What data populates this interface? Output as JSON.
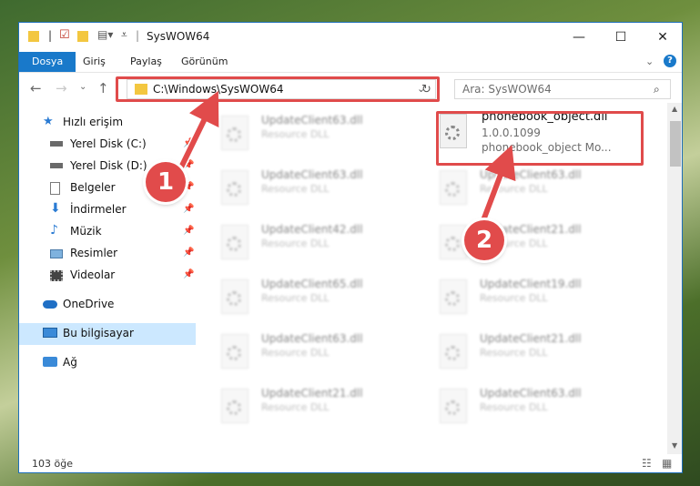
{
  "window": {
    "title": "SysWOW64"
  },
  "ribbon": {
    "tabs": [
      "Dosya",
      "Giriş",
      "Paylaş",
      "Görünüm"
    ]
  },
  "address": {
    "path": "C:\\Windows\\SysWOW64"
  },
  "search": {
    "placeholder": "Ara: SysWOW64"
  },
  "sidebar": {
    "items": [
      {
        "label": "Hızlı erişim",
        "icon": "star-icon"
      },
      {
        "label": "Yerel Disk (C:)",
        "icon": "drive-icon"
      },
      {
        "label": "Yerel Disk (D:)",
        "icon": "drive-icon"
      },
      {
        "label": "Belgeler",
        "icon": "documents-icon"
      },
      {
        "label": "İndirmeler",
        "icon": "download-icon"
      },
      {
        "label": "Müzik",
        "icon": "music-icon"
      },
      {
        "label": "Resimler",
        "icon": "pictures-icon"
      },
      {
        "label": "Videolar",
        "icon": "video-icon"
      },
      {
        "label": "OneDrive",
        "icon": "cloud-icon"
      },
      {
        "label": "Bu bilgisayar",
        "icon": "computer-icon"
      },
      {
        "label": "Ağ",
        "icon": "network-icon"
      }
    ]
  },
  "files": [
    {
      "name": "UpdateClient63.dll",
      "sub": "Resource DLL"
    },
    {
      "name": "phonebook_object.dll",
      "sub": "1.0.0.1099",
      "sub2": "phonebook_object Mo..."
    },
    {
      "name": "UpdateClient63.dll",
      "sub": "Resource DLL"
    },
    {
      "name": "UpdateClient63.dll",
      "sub": "Resource DLL"
    },
    {
      "name": "UpdateClient42.dll",
      "sub": "Resource DLL"
    },
    {
      "name": "UpdateClient21.dll",
      "sub": "Resource DLL"
    },
    {
      "name": "UpdateClient65.dll",
      "sub": "Resource DLL"
    },
    {
      "name": "UpdateClient19.dll",
      "sub": "Resource DLL"
    },
    {
      "name": "UpdateClient63.dll",
      "sub": "Resource DLL"
    },
    {
      "name": "UpdateClient21.dll",
      "sub": "Resource DLL"
    },
    {
      "name": "UpdateClient21.dll",
      "sub": "Resource DLL"
    },
    {
      "name": "UpdateClient63.dll",
      "sub": "Resource DLL"
    }
  ],
  "status": {
    "count": "103 öğe"
  },
  "annotations": {
    "step1": "1",
    "step2": "2"
  }
}
